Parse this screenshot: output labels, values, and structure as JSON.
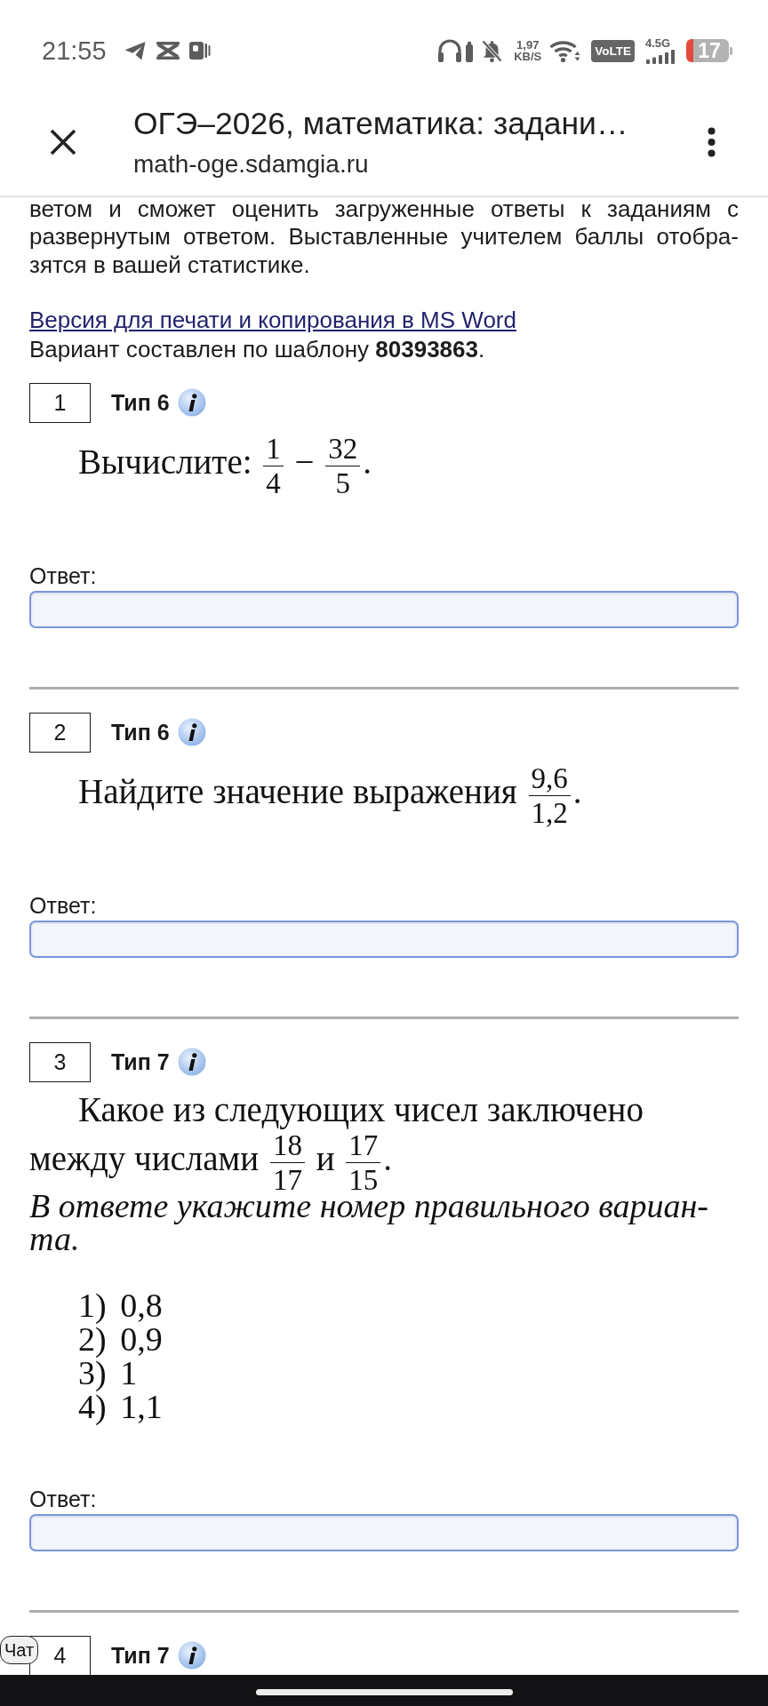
{
  "status_bar": {
    "time": "21:55",
    "net_speed": "1,97",
    "net_speed_unit": "KB/S",
    "volte": "VoLTE",
    "network_type": "4.5G",
    "battery": "17"
  },
  "header": {
    "title": "ОГЭ–2026, математика: задани…",
    "url": "math-oge.sdamgia.ru"
  },
  "intro": {
    "lines": [
      "ветом и сможет оценить загруженные ответы к заданиям с",
      "развернутым ответом. Выставленные учителем баллы отобра-",
      "зятся в вашей статистике."
    ],
    "print_link": "Версия для печати и копирования в MS Word",
    "template_note": "Вариант составлен по шаблону **80393863**."
  },
  "tasks": [
    {
      "number": "1",
      "type_label": "Тип 6",
      "statement": [
        {
          "kind": "text",
          "text": "Вычислите:"
        },
        {
          "kind": "fraction",
          "numerator": "1",
          "denominator": "4"
        },
        {
          "kind": "text",
          "text": "−"
        },
        {
          "kind": "fraction",
          "numerator": "32",
          "denominator": "5",
          "after": "."
        }
      ],
      "answer_label": "Ответ:"
    },
    {
      "number": "2",
      "type_label": "Тип 6",
      "statement": [
        {
          "kind": "text",
          "text": "Найдите значение выражения"
        },
        {
          "kind": "fraction",
          "numerator": "9,6",
          "denominator": "1,2",
          "after": "."
        }
      ],
      "answer_label": "Ответ:"
    },
    {
      "number": "3",
      "type_label": "Тип 7",
      "statement": [
        {
          "kind": "text",
          "text": "Какое из следующих чисел заключено между числами"
        },
        {
          "kind": "fraction",
          "numerator": "18",
          "denominator": "17"
        },
        {
          "kind": "text",
          "text": "и"
        },
        {
          "kind": "fraction",
          "numerator": "17",
          "denominator": "15",
          "after": "."
        }
      ],
      "instruction_lines": [
        "В ответе укажите номер правильного вариан-",
        "та."
      ],
      "options": [
        {
          "marker": "1)",
          "text": "0,8"
        },
        {
          "marker": "2)",
          "text": "0,9"
        },
        {
          "marker": "3)",
          "text": "1"
        },
        {
          "marker": "4)",
          "text": "1,1"
        }
      ],
      "answer_label": "Ответ:"
    },
    {
      "number": "4",
      "type_label": "Тип 7"
    }
  ],
  "chat_button": {
    "label": "Чат"
  }
}
